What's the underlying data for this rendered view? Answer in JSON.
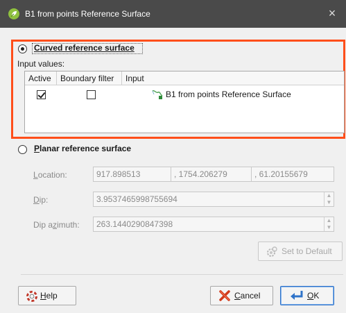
{
  "window": {
    "title": "B1 from points Reference Surface",
    "close_symbol": "×"
  },
  "curved": {
    "label_prefix": "",
    "label_accel": "C",
    "label_rest": "urved reference surface",
    "selected": true,
    "input_values_label": "Input values:",
    "table": {
      "columns": [
        "Active",
        "Boundary filter",
        "Input"
      ],
      "rows": [
        {
          "active": true,
          "boundary_filter": false,
          "input": "B1 from points Reference Surface"
        }
      ]
    }
  },
  "planar": {
    "label_accel": "P",
    "label_rest": "lanar reference surface",
    "selected": false,
    "location_label_accel": "L",
    "location_label_rest": "ocation:",
    "location_x": "917.898513",
    "location_y": ", 1754.206279",
    "location_z": ", 61.20155679",
    "dip_label_accel": "D",
    "dip_label_rest": "ip:",
    "dip_value": "3.9537465998755694",
    "dip_azimuth_label_pre": "Dip a",
    "dip_azimuth_label_accel": "z",
    "dip_azimuth_label_rest": "imuth:",
    "dip_azimuth_value": "263.1440290847398",
    "set_default_label": "Set to Default"
  },
  "buttons": {
    "help_accel": "H",
    "help_rest": "elp",
    "cancel_accel": "C",
    "cancel_rest": "ancel",
    "ok_accel": "O",
    "ok_rest": "K"
  },
  "colors": {
    "highlight": "#ff4e1a",
    "titlebar": "#4a4a4a",
    "app_icon": "#8fc13e"
  },
  "icons": [
    "app-leaf-icon",
    "close-icon",
    "surface-icon",
    "gear-icon",
    "help-lifebuoy-icon",
    "cancel-x-icon",
    "ok-return-icon"
  ]
}
